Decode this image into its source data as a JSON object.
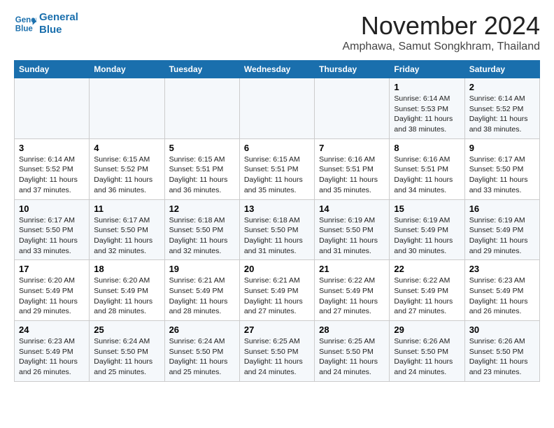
{
  "header": {
    "logo_line1": "General",
    "logo_line2": "Blue",
    "month_title": "November 2024",
    "location": "Amphawa, Samut Songkhram, Thailand"
  },
  "days_of_week": [
    "Sunday",
    "Monday",
    "Tuesday",
    "Wednesday",
    "Thursday",
    "Friday",
    "Saturday"
  ],
  "weeks": [
    [
      {
        "day": "",
        "info": ""
      },
      {
        "day": "",
        "info": ""
      },
      {
        "day": "",
        "info": ""
      },
      {
        "day": "",
        "info": ""
      },
      {
        "day": "",
        "info": ""
      },
      {
        "day": "1",
        "info": "Sunrise: 6:14 AM\nSunset: 5:53 PM\nDaylight: 11 hours\nand 38 minutes."
      },
      {
        "day": "2",
        "info": "Sunrise: 6:14 AM\nSunset: 5:52 PM\nDaylight: 11 hours\nand 38 minutes."
      }
    ],
    [
      {
        "day": "3",
        "info": "Sunrise: 6:14 AM\nSunset: 5:52 PM\nDaylight: 11 hours\nand 37 minutes."
      },
      {
        "day": "4",
        "info": "Sunrise: 6:15 AM\nSunset: 5:52 PM\nDaylight: 11 hours\nand 36 minutes."
      },
      {
        "day": "5",
        "info": "Sunrise: 6:15 AM\nSunset: 5:51 PM\nDaylight: 11 hours\nand 36 minutes."
      },
      {
        "day": "6",
        "info": "Sunrise: 6:15 AM\nSunset: 5:51 PM\nDaylight: 11 hours\nand 35 minutes."
      },
      {
        "day": "7",
        "info": "Sunrise: 6:16 AM\nSunset: 5:51 PM\nDaylight: 11 hours\nand 35 minutes."
      },
      {
        "day": "8",
        "info": "Sunrise: 6:16 AM\nSunset: 5:51 PM\nDaylight: 11 hours\nand 34 minutes."
      },
      {
        "day": "9",
        "info": "Sunrise: 6:17 AM\nSunset: 5:50 PM\nDaylight: 11 hours\nand 33 minutes."
      }
    ],
    [
      {
        "day": "10",
        "info": "Sunrise: 6:17 AM\nSunset: 5:50 PM\nDaylight: 11 hours\nand 33 minutes."
      },
      {
        "day": "11",
        "info": "Sunrise: 6:17 AM\nSunset: 5:50 PM\nDaylight: 11 hours\nand 32 minutes."
      },
      {
        "day": "12",
        "info": "Sunrise: 6:18 AM\nSunset: 5:50 PM\nDaylight: 11 hours\nand 32 minutes."
      },
      {
        "day": "13",
        "info": "Sunrise: 6:18 AM\nSunset: 5:50 PM\nDaylight: 11 hours\nand 31 minutes."
      },
      {
        "day": "14",
        "info": "Sunrise: 6:19 AM\nSunset: 5:50 PM\nDaylight: 11 hours\nand 31 minutes."
      },
      {
        "day": "15",
        "info": "Sunrise: 6:19 AM\nSunset: 5:49 PM\nDaylight: 11 hours\nand 30 minutes."
      },
      {
        "day": "16",
        "info": "Sunrise: 6:19 AM\nSunset: 5:49 PM\nDaylight: 11 hours\nand 29 minutes."
      }
    ],
    [
      {
        "day": "17",
        "info": "Sunrise: 6:20 AM\nSunset: 5:49 PM\nDaylight: 11 hours\nand 29 minutes."
      },
      {
        "day": "18",
        "info": "Sunrise: 6:20 AM\nSunset: 5:49 PM\nDaylight: 11 hours\nand 28 minutes."
      },
      {
        "day": "19",
        "info": "Sunrise: 6:21 AM\nSunset: 5:49 PM\nDaylight: 11 hours\nand 28 minutes."
      },
      {
        "day": "20",
        "info": "Sunrise: 6:21 AM\nSunset: 5:49 PM\nDaylight: 11 hours\nand 27 minutes."
      },
      {
        "day": "21",
        "info": "Sunrise: 6:22 AM\nSunset: 5:49 PM\nDaylight: 11 hours\nand 27 minutes."
      },
      {
        "day": "22",
        "info": "Sunrise: 6:22 AM\nSunset: 5:49 PM\nDaylight: 11 hours\nand 27 minutes."
      },
      {
        "day": "23",
        "info": "Sunrise: 6:23 AM\nSunset: 5:49 PM\nDaylight: 11 hours\nand 26 minutes."
      }
    ],
    [
      {
        "day": "24",
        "info": "Sunrise: 6:23 AM\nSunset: 5:49 PM\nDaylight: 11 hours\nand 26 minutes."
      },
      {
        "day": "25",
        "info": "Sunrise: 6:24 AM\nSunset: 5:50 PM\nDaylight: 11 hours\nand 25 minutes."
      },
      {
        "day": "26",
        "info": "Sunrise: 6:24 AM\nSunset: 5:50 PM\nDaylight: 11 hours\nand 25 minutes."
      },
      {
        "day": "27",
        "info": "Sunrise: 6:25 AM\nSunset: 5:50 PM\nDaylight: 11 hours\nand 24 minutes."
      },
      {
        "day": "28",
        "info": "Sunrise: 6:25 AM\nSunset: 5:50 PM\nDaylight: 11 hours\nand 24 minutes."
      },
      {
        "day": "29",
        "info": "Sunrise: 6:26 AM\nSunset: 5:50 PM\nDaylight: 11 hours\nand 24 minutes."
      },
      {
        "day": "30",
        "info": "Sunrise: 6:26 AM\nSunset: 5:50 PM\nDaylight: 11 hours\nand 23 minutes."
      }
    ]
  ]
}
